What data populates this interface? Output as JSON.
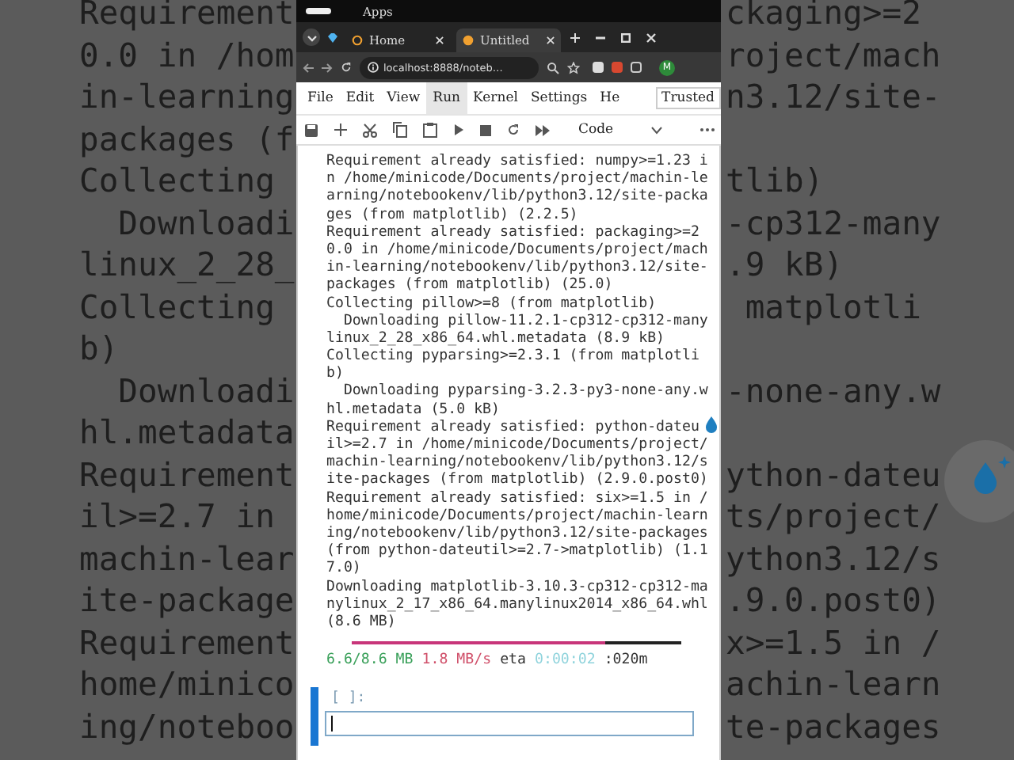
{
  "backdrop": [
    {
      "left": "Requirement",
      "right": "ckaging>=2"
    },
    {
      "left": "0.0 in /hom",
      "right": "roject/mach"
    },
    {
      "left": "in-learning",
      "right": "n3.12/site-"
    },
    {
      "left": "packages (f"
    },
    {
      "left": "Collecting",
      "right": "tlib)"
    },
    {
      "left": "  Downloadi",
      "right": "-cp312-many"
    },
    {
      "left": "linux_2_28_",
      "right": ".9 kB)"
    },
    {
      "left": "Collecting",
      "right": " matplotli"
    },
    {
      "left": "b)"
    },
    {
      "left": "  Downloadi",
      "right": "-none-any.w"
    },
    {
      "left": "hl.metadata"
    },
    {
      "left": "Requirement",
      "right": "ython-dateu"
    },
    {
      "left": "il>=2.7 in",
      "right": "ts/project/"
    },
    {
      "left": "machin-lear",
      "right": "ython3.12/s"
    },
    {
      "left": "ite-package",
      "right": ".9.0.post0)"
    },
    {
      "left": "Requirement",
      "right": "x>=1.5 in /"
    },
    {
      "left": "home/minico",
      "right": "achin-learn"
    },
    {
      "left": "ing/noteboo",
      "right": "te-packages"
    }
  ],
  "top_bar": {
    "title": "Apps"
  },
  "tabs": [
    {
      "label": "Home",
      "selected": false
    },
    {
      "label": "Untitled",
      "selected": true
    }
  ],
  "address": {
    "url": "localhost:8888/noteb…",
    "avatar": "M"
  },
  "menu": [
    {
      "label": "File",
      "selected": false
    },
    {
      "label": "Edit",
      "selected": false
    },
    {
      "label": "View",
      "selected": false
    },
    {
      "label": "Run",
      "selected": true
    },
    {
      "label": "Kernel",
      "selected": false
    },
    {
      "label": "Settings",
      "selected": false
    },
    {
      "label": "He",
      "selected": false
    }
  ],
  "trusted": "Trusted",
  "cell_type": "Code",
  "output_lines": [
    "Requirement already satisfied: numpy>=1.23 i",
    "n /home/minicode/Documents/project/machin-le",
    "arning/notebookenv/lib/python3.12/site-packa",
    "ges (from matplotlib) (2.2.5)",
    "Requirement already satisfied: packaging>=2",
    "0.0 in /home/minicode/Documents/project/mach",
    "in-learning/notebookenv/lib/python3.12/site-",
    "packages (from matplotlib) (25.0)",
    "Collecting pillow>=8 (from matplotlib)",
    "  Downloading pillow-11.2.1-cp312-cp312-many",
    "linux_2_28_x86_64.whl.metadata (8.9 kB)",
    "Collecting pyparsing>=2.3.1 (from matplotli",
    "b)",
    "  Downloading pyparsing-3.2.3-py3-none-any.w",
    "hl.metadata (5.0 kB)",
    "Requirement already satisfied: python-dateu",
    "il>=2.7 in /home/minicode/Documents/project/",
    "machin-learning/notebookenv/lib/python3.12/s",
    "ite-packages (from matplotlib) (2.9.0.post0)",
    "Requirement already satisfied: six>=1.5 in /",
    "home/minicode/Documents/project/machin-learn",
    "ing/notebookenv/lib/python3.12/site-packages",
    "(from python-dateutil>=2.7->matplotlib) (1.1",
    "7.0)",
    "Downloading matplotlib-3.10.3-cp312-cp312-ma",
    "nylinux_2_17_x86_64.manylinux2014_x86_64.whl",
    "(8.6 MB)"
  ],
  "progress": {
    "level": 0.77,
    "segments": [
      {
        "text": "6.6/8.6 MB",
        "kind": "size"
      },
      {
        "text": "1.8 MB/s",
        "kind": "speed"
      },
      {
        "text": "eta",
        "kind": "plain"
      },
      {
        "text": "0:00:02",
        "kind": "time"
      },
      {
        "text": ":020m",
        "kind": "plain"
      }
    ]
  },
  "prompt": "[ ]:"
}
